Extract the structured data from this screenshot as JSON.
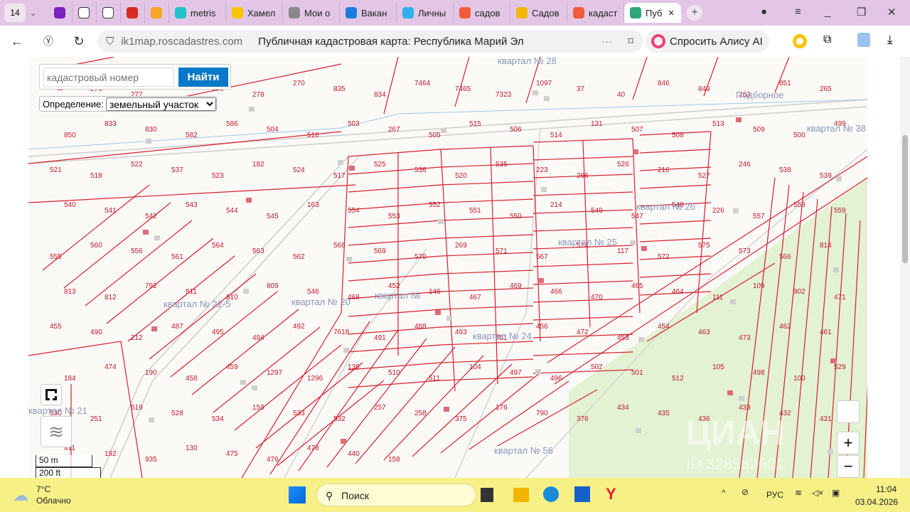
{
  "browser": {
    "tab_count": "14",
    "tabs": [
      {
        "label": "",
        "icon": "w-icon",
        "color": "#7a1fc0"
      },
      {
        "label": "",
        "icon": "doc-icon",
        "color": "#fff"
      },
      {
        "label": "",
        "icon": "doc-icon",
        "color": "#fff"
      },
      {
        "label": "",
        "icon": "flag-icon",
        "color": "#d52b1e"
      },
      {
        "label": "",
        "icon": "hand-icon",
        "color": "#f5a623"
      },
      {
        "label": "metris",
        "icon": "cube-icon",
        "color": "#20c3c8"
      },
      {
        "label": "Хамел",
        "icon": "play-icon",
        "color": "#f7c600"
      },
      {
        "label": "Мои о",
        "icon": "chart-icon",
        "color": "#888"
      },
      {
        "label": "Вакан",
        "icon": "gp-icon",
        "color": "#1a7ee0"
      },
      {
        "label": "Личны",
        "icon": "dots-icon",
        "color": "#2fb0e8"
      },
      {
        "label": "садов",
        "icon": "yandex-icon",
        "color": "#f15a3a"
      },
      {
        "label": "Садов",
        "icon": "image-icon",
        "color": "#f2b705"
      },
      {
        "label": "кадаст",
        "icon": "yandex-icon",
        "color": "#f15a3a"
      },
      {
        "label": "Пуб",
        "icon": "pkk-icon",
        "color": "#2aa87a"
      }
    ],
    "url": "ik1map.roscadastres.com",
    "page_title": "Публичная кадастровая карта: Республика Марий Эл",
    "alice_label": "Спросить Алису AI"
  },
  "map": {
    "search_placeholder": "кадастровый номер",
    "search_button": "Найти",
    "definition_label": "Определение:",
    "definition_value": "земельный участок",
    "scale_m": "50 m",
    "scale_ft": "200 ft",
    "zoom_in": "+",
    "zoom_out": "−",
    "watermark": "ЦИАН",
    "watermark_id": "ID 328562601",
    "place_label": "Подборное",
    "quarters": [
      "квартал № 28",
      "квартал № 26",
      "квартал № 25",
      "квартал № 24",
      "квартал № 20",
      "квартал № 22-5",
      "квартал № 21",
      "квартал № 56",
      "квартал № 38",
      "квартал №"
    ],
    "parcels": [
      "276",
      "276",
      "277",
      "277",
      "278",
      "278",
      "270",
      "835",
      "834",
      "7464",
      "7465",
      "7323",
      "1097",
      "37",
      "40",
      "846",
      "849",
      "263",
      "851",
      "265",
      "850",
      "833",
      "830",
      "582",
      "586",
      "504",
      "516",
      "503",
      "267",
      "505",
      "515",
      "506",
      "514",
      "131",
      "507",
      "508",
      "513",
      "509",
      "500",
      "499",
      "521",
      "518",
      "522",
      "537",
      "523",
      "182",
      "524",
      "517",
      "525",
      "536",
      "520",
      "535",
      "223",
      "266",
      "526",
      "216",
      "527",
      "246",
      "538",
      "539",
      "540",
      "541",
      "542",
      "543",
      "544",
      "545",
      "163",
      "554",
      "553",
      "552",
      "551",
      "550",
      "214",
      "549",
      "547",
      "548",
      "226",
      "557",
      "558",
      "559",
      "555",
      "560",
      "556",
      "561",
      "564",
      "563",
      "562",
      "568",
      "569",
      "570",
      "269",
      "571",
      "567",
      "574",
      "117",
      "572",
      "575",
      "573",
      "566",
      "814",
      "813",
      "812",
      "792",
      "811",
      "810",
      "809",
      "546",
      "468",
      "452",
      "146",
      "467",
      "469",
      "466",
      "470",
      "465",
      "464",
      "111",
      "109",
      "902",
      "471",
      "455",
      "490",
      "212",
      "487",
      "495",
      "494",
      "492",
      "7618",
      "491",
      "488",
      "493",
      "451",
      "456",
      "472",
      "453",
      "454",
      "463",
      "473",
      "462",
      "461",
      "184",
      "474",
      "190",
      "458",
      "459",
      "1297",
      "1296",
      "139",
      "510",
      "511",
      "104",
      "497",
      "496",
      "502",
      "501",
      "512",
      "105",
      "498",
      "100",
      "529",
      "530",
      "251",
      "519",
      "528",
      "534",
      "159",
      "533",
      "532",
      "257",
      "258",
      "375",
      "176",
      "790",
      "376",
      "434",
      "435",
      "436",
      "433",
      "432",
      "431",
      "411",
      "192",
      "935",
      "130",
      "475",
      "476",
      "478",
      "440",
      "158"
    ]
  },
  "taskbar": {
    "temp": "7°C",
    "weather": "Облачно",
    "search": "Поиск",
    "lang": "РУС",
    "time": "11:04",
    "date": "03.04.2026"
  }
}
